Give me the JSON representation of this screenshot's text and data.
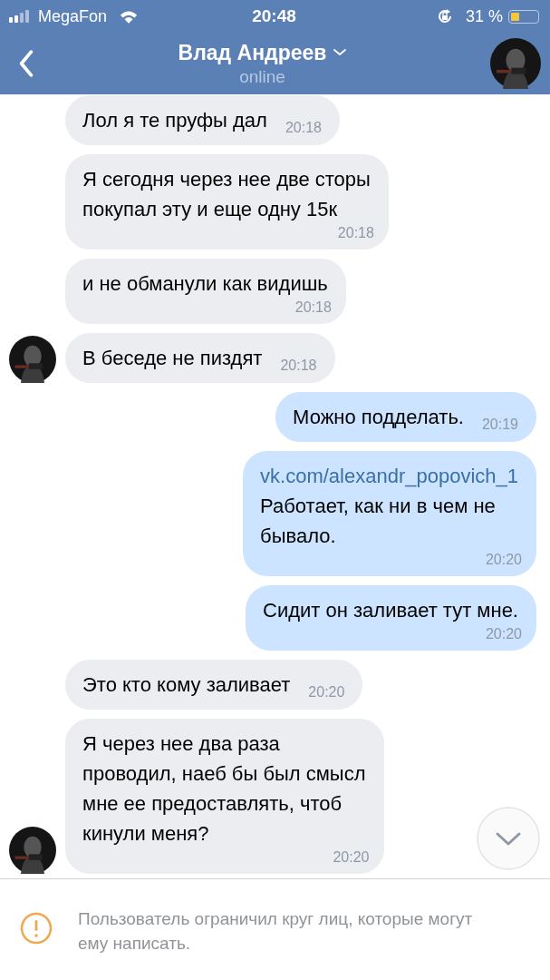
{
  "status_bar": {
    "carrier": "MegaFon",
    "time": "20:48",
    "battery": "31 %"
  },
  "header": {
    "title": "Влад Андреев",
    "subtitle": "online"
  },
  "messages": [
    {
      "kind": "incoming",
      "avatar": false,
      "lines": [
        "Лол я те пруфы дал"
      ],
      "time": "20:18",
      "time_below": false
    },
    {
      "kind": "incoming",
      "avatar": false,
      "lines": [
        "Я сегодня через нее две сторы",
        "покупал эту и еще одну 15к"
      ],
      "time": "20:18",
      "time_below": true
    },
    {
      "kind": "incoming",
      "avatar": false,
      "lines": [
        "и не обманули как видишь"
      ],
      "time": "20:18",
      "time_below": true
    },
    {
      "kind": "incoming",
      "avatar": true,
      "lines": [
        "В беседе не пиздят"
      ],
      "time": "20:18",
      "time_below": false
    },
    {
      "kind": "outgoing",
      "lines": [
        "Можно подделать."
      ],
      "time": "20:19",
      "time_below": false
    },
    {
      "kind": "outgoing",
      "link": "vk.com/alexandr_popovich_1",
      "lines": [
        "Работает, как ни в чем не",
        "бывало."
      ],
      "time": "20:20",
      "time_below": true
    },
    {
      "kind": "outgoing",
      "lines": [
        "Сидит он заливает тут мне."
      ],
      "time": "20:20",
      "time_below": true
    },
    {
      "kind": "incoming",
      "avatar": false,
      "lines": [
        "Это кто кому заливает"
      ],
      "time": "20:20",
      "time_below": false
    },
    {
      "kind": "incoming",
      "avatar": true,
      "lines": [
        "Я через нее два раза",
        "проводил, наеб бы был смысл",
        "мне ее предоставлять, чтоб",
        "кинули меня?"
      ],
      "time": "20:20",
      "time_below": true
    }
  ],
  "notice": "Пользователь ограничил круг лиц, которые могут ему написать."
}
